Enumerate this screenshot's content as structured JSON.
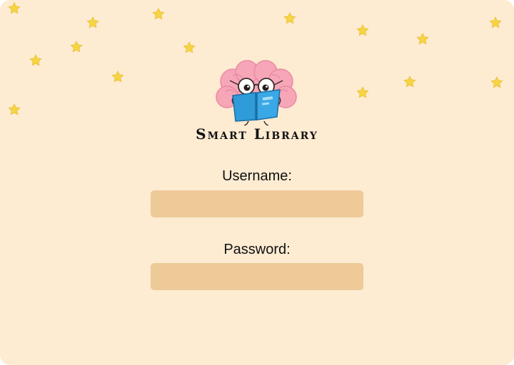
{
  "app": {
    "title": "Smart Library"
  },
  "login": {
    "username_label": "Username:",
    "username_value": "",
    "password_label": "Password:",
    "password_value": ""
  },
  "colors": {
    "background": "#fdebd2",
    "field": "#edca98",
    "star": "#f6d545",
    "brain": "#f7a6b8",
    "book": "#2f9bd9"
  },
  "icons": {
    "background_decoration": "star-icon",
    "logo": "brain-reading-book-icon"
  }
}
